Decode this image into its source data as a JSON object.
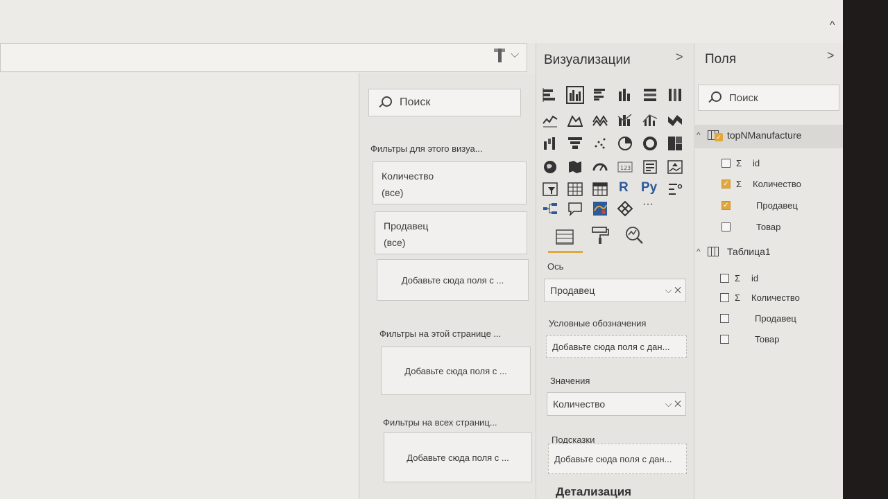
{
  "filters": {
    "search_placeholder": "Поиск",
    "visual_section": "Фильтры для этого визуа...",
    "cards": [
      {
        "field": "Количество",
        "value": "(все)"
      },
      {
        "field": "Продавец",
        "value": "(все)"
      }
    ],
    "add_here": "Добавьте сюда поля с ...",
    "page_section": "Фильтры на этой странице ...",
    "all_section": "Фильтры на всех страниц..."
  },
  "visualizations": {
    "title": "Визуализации",
    "more": "···",
    "axis_label": "Ось",
    "axis_value": "Продавец",
    "legend_label": "Условные обозначения",
    "legend_placeholder": "Добавьте сюда поля с дан...",
    "values_label": "Значения",
    "values_value": "Количество",
    "tooltips_label": "Подсказки",
    "tooltips_placeholder": "Добавьте сюда поля с дан...",
    "drill_label": "Детализация",
    "icons": [
      "stacked-bar-icon",
      "clustered-column-icon",
      "clustered-bar-icon",
      "stacked-column-icon",
      "100-bar-icon",
      "100-column-icon",
      "line-chart-icon",
      "area-chart-icon",
      "stacked-area-icon",
      "line-column-icon",
      "line-clustered-icon",
      "ribbon-chart-icon",
      "waterfall-icon",
      "funnel-icon",
      "scatter-icon",
      "pie-chart-icon",
      "donut-chart-icon",
      "treemap-icon",
      "map-icon",
      "filled-map-icon",
      "gauge-icon",
      "card-icon",
      "multirow-card-icon",
      "kpi-icon",
      "slicer-icon",
      "table-icon",
      "matrix-icon",
      "r-visual-icon",
      "python-visual-icon",
      "key-influencers-icon",
      "decomposition-tree-icon",
      "qa-icon",
      "arcgis-icon",
      "power-apps-icon"
    ],
    "accent": "#e1a73b",
    "r_label": "R",
    "py_label": "Py"
  },
  "fields": {
    "title": "Поля",
    "search_placeholder": "Поиск",
    "tables": [
      {
        "name": "topNManufacture",
        "checked": true,
        "columns": [
          {
            "name": "id",
            "sigma": true,
            "checked": false
          },
          {
            "name": "Количество",
            "sigma": true,
            "checked": true
          },
          {
            "name": "Продавец",
            "sigma": false,
            "checked": true
          },
          {
            "name": "Товар",
            "sigma": false,
            "checked": false
          }
        ]
      },
      {
        "name": "Таблица1",
        "checked": false,
        "columns": [
          {
            "name": "id",
            "sigma": true,
            "checked": false
          },
          {
            "name": "Количество",
            "sigma": true,
            "checked": false
          },
          {
            "name": "Продавец",
            "sigma": false,
            "checked": false
          },
          {
            "name": "Товар",
            "sigma": false,
            "checked": false
          }
        ]
      }
    ],
    "sigma_symbol": "Σ"
  },
  "chrome": {
    "up_chevron": "^",
    "dropdown_chevron": "⌵",
    "pane_chevron": ">"
  }
}
